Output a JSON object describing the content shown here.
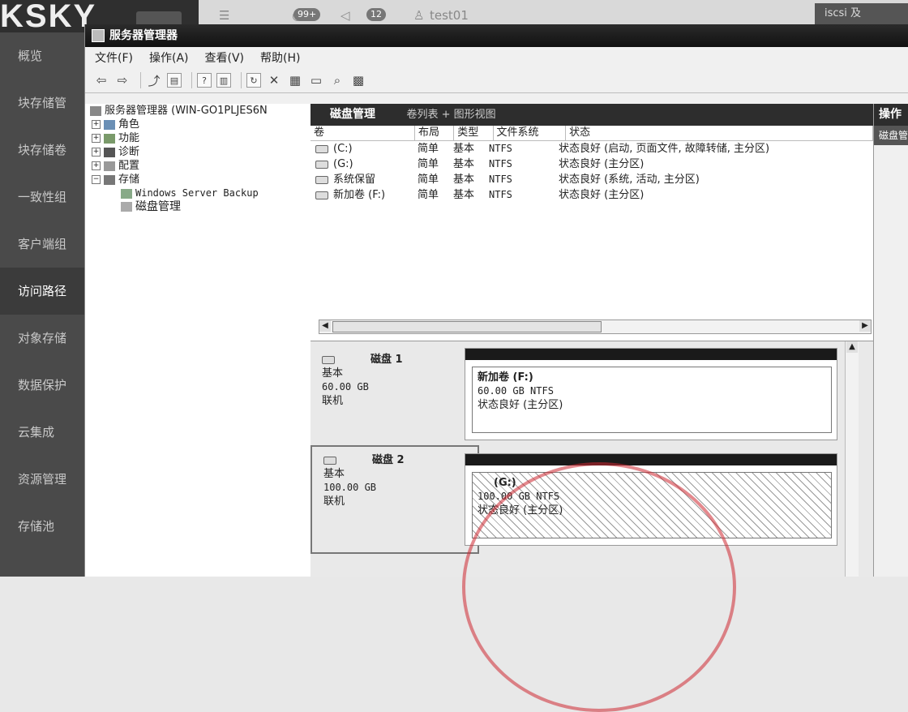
{
  "bg": {
    "logo": "KSKY",
    "badges": [
      "99+",
      "12"
    ],
    "user": "test01",
    "right_top": "iscsi 及",
    "sidebar": [
      "概览",
      "块存储管",
      "块存储卷",
      "一致性组",
      "客户端组",
      "访问路径",
      "对象存储",
      "数据保护",
      "云集成",
      "资源管理",
      "存储池"
    ],
    "sidebar_active": 5
  },
  "window": {
    "title": "服务器管理器",
    "menu": [
      "文件(F)",
      "操作(A)",
      "查看(V)",
      "帮助(H)"
    ]
  },
  "tree": {
    "root": "服务器管理器 (WIN-GO1PLJES6N",
    "items": [
      "角色",
      "功能",
      "诊断",
      "配置",
      "存储"
    ],
    "children": [
      "Windows Server Backup",
      "磁盘管理"
    ]
  },
  "pane": {
    "title": "磁盘管理",
    "subtitle": "卷列表 + 图形视图",
    "columns": [
      "卷",
      "布局",
      "类型",
      "文件系统",
      "状态"
    ],
    "rows": [
      {
        "vol": "(C:)",
        "layout": "简单",
        "type": "基本",
        "fs": "NTFS",
        "status": "状态良好 (启动, 页面文件, 故障转储, 主分区)"
      },
      {
        "vol": "(G:)",
        "layout": "简单",
        "type": "基本",
        "fs": "NTFS",
        "status": "状态良好 (主分区)"
      },
      {
        "vol": "系统保留",
        "layout": "简单",
        "type": "基本",
        "fs": "NTFS",
        "status": "状态良好 (系统, 活动, 主分区)"
      },
      {
        "vol": "新加卷 (F:)",
        "layout": "简单",
        "type": "基本",
        "fs": "NTFS",
        "status": "状态良好 (主分区)"
      }
    ]
  },
  "disks": [
    {
      "name": "磁盘 1",
      "type": "基本",
      "size": "60.00 GB",
      "state": "联机",
      "part_name": "新加卷 (F:)",
      "part_size": "60.00 GB NTFS",
      "part_status": "状态良好 (主分区)"
    },
    {
      "name": "磁盘 2",
      "type": "基本",
      "size": "100.00 GB",
      "state": "联机",
      "part_name": "(G:)",
      "part_size": "100.00 GB NTFS",
      "part_status": "状态良好 (主分区)"
    }
  ],
  "actions": {
    "title": "操作",
    "sub": "磁盘管理"
  }
}
